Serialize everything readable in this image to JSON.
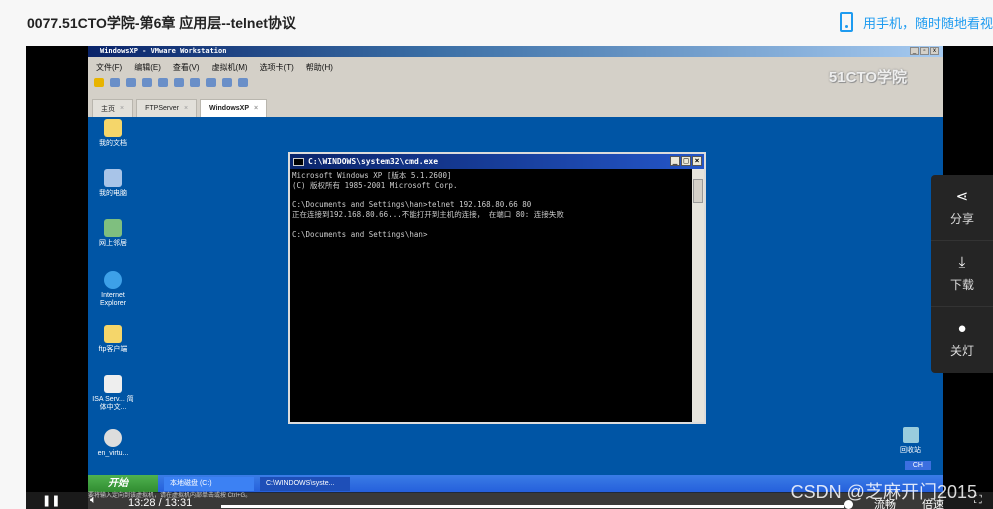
{
  "page": {
    "title": "0077.51CTO学院-第6章 应用层--telnet协议",
    "mobile_link": "用手机，随时随地看视"
  },
  "vmware": {
    "window_title": "WindowsXP - VMware Workstation",
    "logo": "51CTO学院",
    "menu": [
      "文件(F)",
      "编辑(E)",
      "查看(V)",
      "虚拟机(M)",
      "选项卡(T)",
      "帮助(H)"
    ],
    "tabs": [
      {
        "label": "主页"
      },
      {
        "label": "FTPServer"
      },
      {
        "label": "WindowsXP"
      }
    ]
  },
  "desktop": {
    "icons": [
      "我的文档",
      "我的电脑",
      "网上邻居",
      "Internet Explorer",
      "ftp客户端",
      "ISA Serv... 简体中文...",
      "en_virtu..."
    ],
    "recycle_bin": "回收站",
    "ime": "CH"
  },
  "cmd": {
    "title": "C:\\WINDOWS\\system32\\cmd.exe",
    "lines": [
      "Microsoft Windows XP [版本 5.1.2600]",
      "(C) 版权所有 1985-2001 Microsoft Corp.",
      "",
      "C:\\Documents and Settings\\han>telnet 192.168.80.66 80",
      "正在连接到192.168.80.66...不能打开到主机的连接， 在端口 80: 连接失败",
      "",
      "C:\\Documents and Settings\\han>"
    ]
  },
  "taskbar": {
    "start": "开始",
    "items": [
      "本地磁盘 (C:)",
      "C:\\WINDOWS\\syste..."
    ]
  },
  "side_panel": [
    {
      "label": "分享",
      "icon": "share-icon"
    },
    {
      "label": "下载",
      "icon": "download-icon"
    },
    {
      "label": "关灯",
      "icon": "bulb-icon"
    }
  ],
  "player": {
    "hint": "要将输入定向到该虚拟机，请在虚拟机内部单击或按 Ctrl+G。",
    "time": "13:28 / 13:31",
    "progress": 0.996,
    "quality": "流畅",
    "speed": "倍速"
  },
  "watermark": "CSDN @芝麻开门2015"
}
